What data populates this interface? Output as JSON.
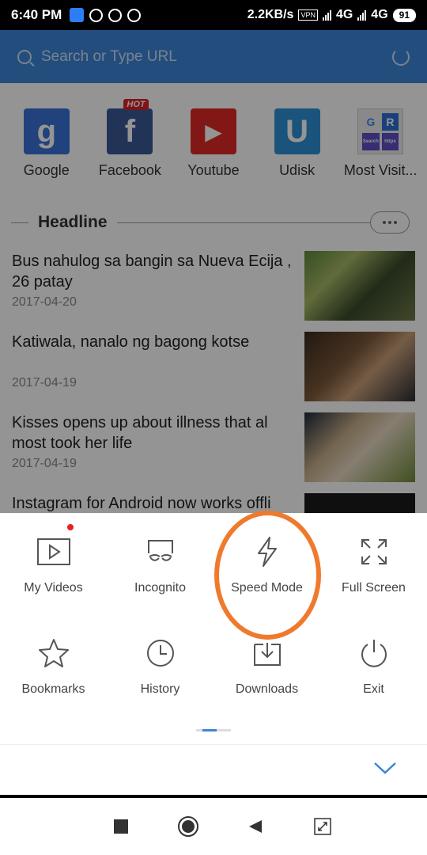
{
  "status_bar": {
    "time": "6:40 PM",
    "speed": "2.2KB/s",
    "vpn": "VPN",
    "net1": "4G",
    "net2": "4G",
    "battery": "91"
  },
  "browser": {
    "search_placeholder": "Search or Type URL",
    "shortcuts": [
      {
        "label": "Google",
        "icon": "google-icon",
        "color": "#3a72d8"
      },
      {
        "label": "Facebook",
        "icon": "facebook-icon",
        "color": "#3b5998",
        "badge": "HOT"
      },
      {
        "label": "Youtube",
        "icon": "youtube-icon",
        "color": "#e02a25"
      },
      {
        "label": "Udisk",
        "icon": "udisk-icon",
        "color": "#2d8fd5"
      },
      {
        "label": "Most Visit...",
        "icon": "most-visited-icon",
        "color": "#ececec"
      }
    ],
    "headline_title": "Headline",
    "news": [
      {
        "title": "Bus nahulog sa bangin sa Nueva Ecija , 26 patay",
        "date": "2017-04-20"
      },
      {
        "title": "Katiwala, nanalo ng bagong kotse",
        "date": "2017-04-19"
      },
      {
        "title": "Kisses opens up about illness that al most took her life",
        "date": "2017-04-19"
      },
      {
        "title": "Instagram for Android now works offli",
        "date": ""
      }
    ]
  },
  "menu": {
    "items": [
      {
        "label": "My Videos",
        "icon": "video-icon"
      },
      {
        "label": "Incognito",
        "icon": "incognito-icon"
      },
      {
        "label": "Speed Mode",
        "icon": "lightning-icon"
      },
      {
        "label": "Full Screen",
        "icon": "fullscreen-icon"
      },
      {
        "label": "Bookmarks",
        "icon": "star-icon"
      },
      {
        "label": "History",
        "icon": "clock-icon"
      },
      {
        "label": "Downloads",
        "icon": "download-icon"
      },
      {
        "label": "Exit",
        "icon": "power-icon"
      }
    ],
    "accent_color": "#3d86d8",
    "highlight_color": "#ef7a2d"
  },
  "mv_letters": [
    "G",
    "R",
    "Search",
    "https"
  ]
}
